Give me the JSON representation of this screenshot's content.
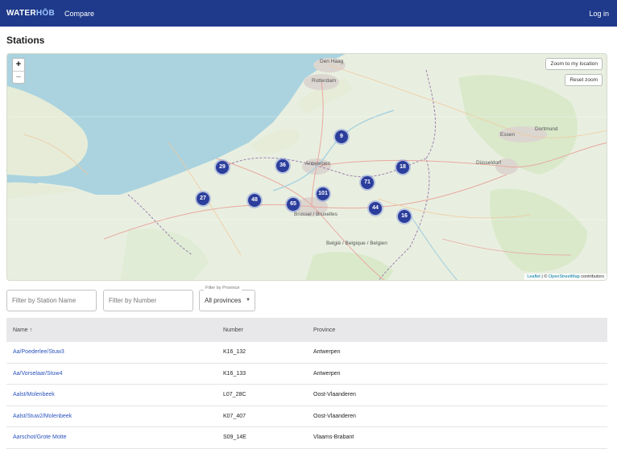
{
  "header": {
    "brand_water": "WATER",
    "brand_hub": "HŌB",
    "nav_compare": "Compare",
    "login": "Log in",
    "bg_color": "#1f3a8a"
  },
  "page": {
    "title": "Stations"
  },
  "map": {
    "zoom_in": "+",
    "zoom_out": "−",
    "zoom_to_location": "Zoom to my location",
    "reset_zoom": "Reset zoom",
    "attribution_leaflet": "Leaflet",
    "attribution_sep": " | © ",
    "attribution_osm": "OpenStreetMap",
    "attribution_tail": " contributors",
    "labels": {
      "den_haag": "Den Haag",
      "rotterdam": "Rotterdam",
      "brussels": "Brussel / Bruxelles",
      "belgie": "België / Belgique / Belgien",
      "dusseldorf": "Düsseldorf",
      "dortmund": "Dortmund",
      "essen": "Essen",
      "antwerpen": "Antwerpen"
    },
    "clusters": [
      {
        "count": "9"
      },
      {
        "count": "29"
      },
      {
        "count": "36"
      },
      {
        "count": "18"
      },
      {
        "count": "71"
      },
      {
        "count": "27"
      },
      {
        "count": "48"
      },
      {
        "count": "65"
      },
      {
        "count": "101"
      },
      {
        "count": "44"
      },
      {
        "count": "16"
      }
    ],
    "marker_color": "#2c3e9c"
  },
  "filters": {
    "station_name_placeholder": "Filter by Station Name",
    "number_placeholder": "Filter by Number",
    "province_label": "Filter by Province",
    "province_value": "All provinces"
  },
  "table": {
    "columns": {
      "name": "Name ↑",
      "number": "Number",
      "province": "Province"
    },
    "rows": [
      {
        "name": "Aa/Poederlee/Stuw3",
        "number": "K16_132",
        "province": "Antwerpen"
      },
      {
        "name": "Aa/Vorselaar/Stuw4",
        "number": "K16_133",
        "province": "Antwerpen"
      },
      {
        "name": "Aalst/Molenbeek",
        "number": "L07_28C",
        "province": "Oost-Vlaanderen"
      },
      {
        "name": "Aalst/Stuw2/Molenbeek",
        "number": "K07_407",
        "province": "Oost-Vlaanderen"
      },
      {
        "name": "Aarschot/Grote Motte",
        "number": "S09_14E",
        "province": "Vlaams-Brabant"
      }
    ]
  }
}
